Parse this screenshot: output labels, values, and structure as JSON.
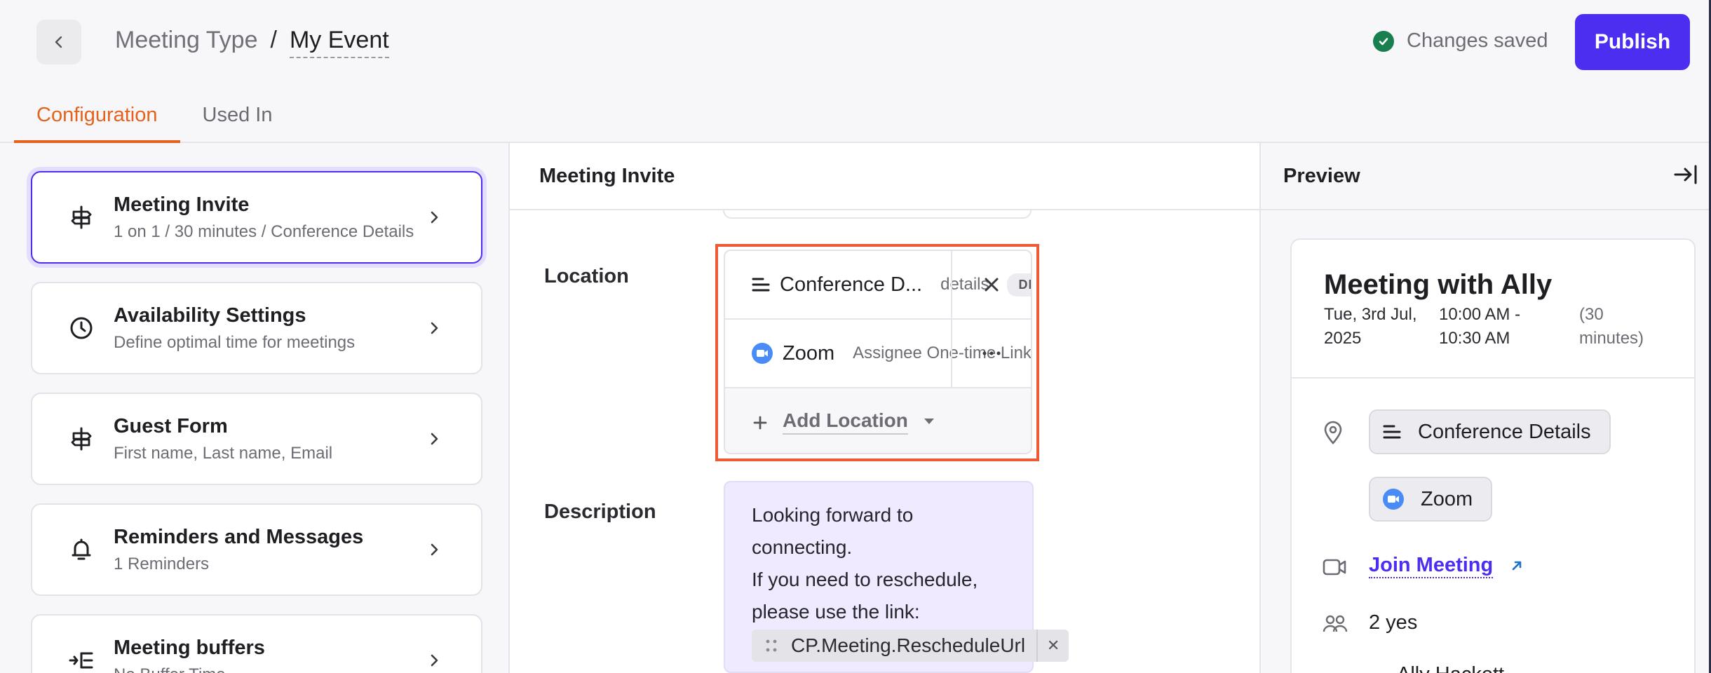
{
  "header": {
    "breadcrumb_parent": "Meeting Type",
    "breadcrumb_separator": "/",
    "breadcrumb_current": "My Event",
    "save_status": "Changes saved",
    "publish_label": "Publish"
  },
  "tabs": [
    {
      "label": "Configuration",
      "active": true
    },
    {
      "label": "Used In",
      "active": false
    }
  ],
  "sidebar": {
    "items": [
      {
        "title": "Meeting Invite",
        "subtitle": "1 on 1 / 30 minutes / Conference Details",
        "icon": "signpost-icon",
        "active": true
      },
      {
        "title": "Availability Settings",
        "subtitle": "Define optimal time for meetings",
        "icon": "clock-icon"
      },
      {
        "title": "Guest Form",
        "subtitle": "First name, Last name, Email",
        "icon": "signpost-icon"
      },
      {
        "title": "Reminders and Messages",
        "subtitle": "1 Reminders",
        "icon": "bell-icon"
      },
      {
        "title": "Meeting buffers",
        "subtitle": "No Buffer Time",
        "icon": "buffer-icon"
      }
    ]
  },
  "main": {
    "title": "Meeting Invite",
    "location_label": "Location",
    "locations": [
      {
        "name": "Conference D...",
        "detail": "details",
        "badge": "DEFAULT",
        "icon": "list-lines-icon",
        "action": "close-icon"
      },
      {
        "name": "Zoom",
        "detail": "Assignee One-time Link",
        "icon": "zoom-icon",
        "action": "more-icon"
      }
    ],
    "add_location_label": "Add Location",
    "description_label": "Description",
    "description_line1": "Looking forward to connecting.",
    "description_line2": "If you need to reschedule, please use the link:",
    "description_token": "CP.Meeting.RescheduleUrl"
  },
  "preview": {
    "title": "Preview",
    "meeting_title": "Meeting with Ally",
    "date_line1": "Tue, 3rd Jul,",
    "date_line2": "2025",
    "time_line1": "10:00 AM -",
    "time_line2": "10:30 AM",
    "duration_line1": "(30",
    "duration_line2": "minutes)",
    "location_chips": [
      "Conference Details",
      "Zoom"
    ],
    "join_label": "Join Meeting",
    "attendees_text": "2 yes",
    "partial_text": "Ally Hackett"
  },
  "colors": {
    "accent": "#4b2ef0",
    "tab_active": "#e5621c",
    "highlight": "#ee5a36",
    "saved_green": "#1a7f4f",
    "zoom_blue": "#4a8cf7"
  }
}
